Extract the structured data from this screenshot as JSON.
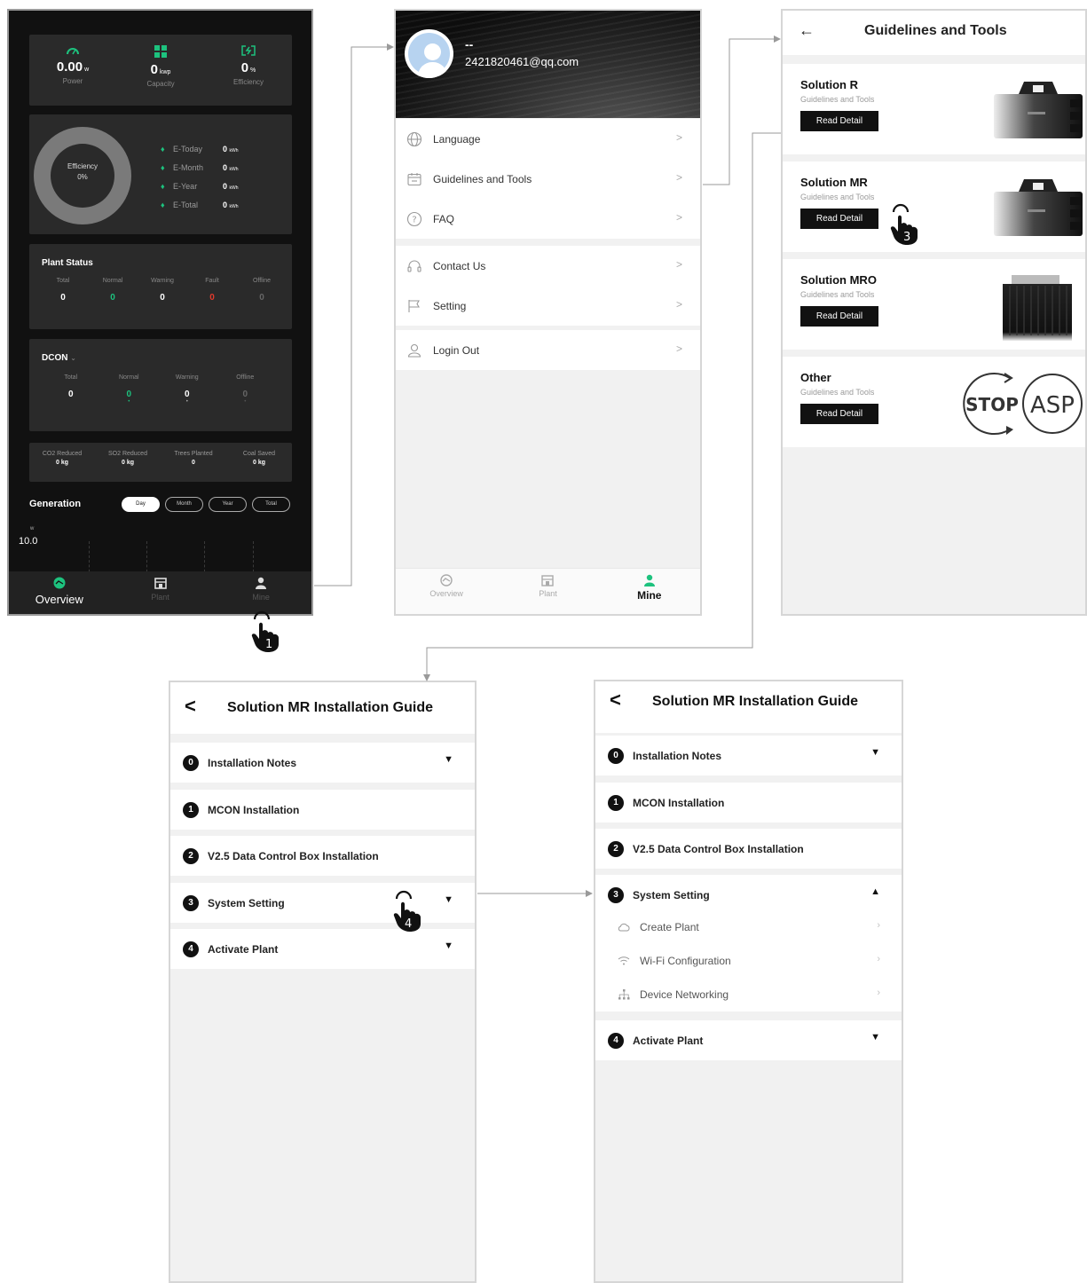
{
  "overview": {
    "metrics": [
      {
        "value": "0.00",
        "unit": "w",
        "label": "Power",
        "icon": "gauge-icon"
      },
      {
        "value": "0",
        "unit": "kwp",
        "label": "Capacity",
        "icon": "grid-icon"
      },
      {
        "value": "0",
        "unit": "%",
        "label": "Efficiency",
        "icon": "efficiency-icon"
      }
    ],
    "efficiency_label": "Efficiency",
    "efficiency_value": "0%",
    "energy": [
      {
        "label": "E-Today",
        "value": "0",
        "unit": "kWh"
      },
      {
        "label": "E-Month",
        "value": "0",
        "unit": "kWh"
      },
      {
        "label": "E-Year",
        "value": "0",
        "unit": "kWh"
      },
      {
        "label": "E-Total",
        "value": "0",
        "unit": "kWh"
      }
    ],
    "plant_status": {
      "title": "Plant Status",
      "cols": [
        {
          "label": "Total",
          "value": "0"
        },
        {
          "label": "Normal",
          "value": "0"
        },
        {
          "label": "Warning",
          "value": "0"
        },
        {
          "label": "Fault",
          "value": "0"
        },
        {
          "label": "Offline",
          "value": "0"
        }
      ]
    },
    "dcon": {
      "title": "DCON",
      "cols": [
        {
          "label": "Total",
          "value": "0"
        },
        {
          "label": "Normal",
          "value": "0"
        },
        {
          "label": "Warning",
          "value": "0"
        },
        {
          "label": "Offline",
          "value": "0"
        }
      ]
    },
    "reductions": [
      {
        "label": "CO2 Reduced",
        "value": "0 kg"
      },
      {
        "label": "SO2 Reduced",
        "value": "0 kg"
      },
      {
        "label": "Trees Planted",
        "value": "0"
      },
      {
        "label": "Coal Saved",
        "value": "0 kg"
      }
    ],
    "generation": {
      "title": "Generation",
      "tabs": [
        "Day",
        "Month",
        "Year",
        "Total"
      ],
      "active_tab": "Day",
      "y_unit": "w",
      "y_tick": "10.0"
    },
    "tabbar": [
      "Overview",
      "Plant",
      "Mine"
    ]
  },
  "mine": {
    "user_name": "--",
    "email": "2421820461@qq.com",
    "menu_group_1": [
      {
        "label": "Language",
        "icon": "globe-icon"
      },
      {
        "label": "Guidelines and Tools",
        "icon": "calendar-icon"
      },
      {
        "label": "FAQ",
        "icon": "question-icon"
      }
    ],
    "menu_group_2": [
      {
        "label": "Contact Us",
        "icon": "headset-icon"
      },
      {
        "label": "Setting",
        "icon": "flag-icon"
      }
    ],
    "menu_group_3": [
      {
        "label": "Login Out",
        "icon": "user-icon"
      }
    ],
    "chevron": ">",
    "tabbar": [
      "Overview",
      "Plant",
      "Mine"
    ]
  },
  "guidelines": {
    "title": "Guidelines and Tools",
    "solutions": [
      {
        "name": "Solution R",
        "subtitle": "Guidelines and Tools",
        "button": "Read Detail"
      },
      {
        "name": "Solution MR",
        "subtitle": "Guidelines and Tools",
        "button": "Read Detail"
      },
      {
        "name": "Solution MRO",
        "subtitle": "Guidelines and Tools",
        "button": "Read Detail"
      },
      {
        "name": "Other",
        "subtitle": "Guidelines and Tools",
        "button": "Read Detail"
      }
    ],
    "logo_stop": "STOP",
    "logo_asp": "ASP"
  },
  "guide_collapsed": {
    "title": "Solution MR Installation Guide",
    "items": [
      {
        "num": "0",
        "label": "Installation Notes"
      },
      {
        "num": "1",
        "label": "MCON Installation"
      },
      {
        "num": "2",
        "label": "V2.5  Data Control Box Installation"
      },
      {
        "num": "3",
        "label": "System Setting"
      },
      {
        "num": "4",
        "label": "Activate Plant"
      }
    ]
  },
  "guide_expanded": {
    "title": "Solution MR Installation Guide",
    "items": [
      {
        "num": "0",
        "label": "Installation Notes"
      },
      {
        "num": "1",
        "label": "MCON Installation"
      },
      {
        "num": "2",
        "label": "V2.5  Data Control Box Installation"
      },
      {
        "num": "3",
        "label": "System Setting"
      },
      {
        "num": "4",
        "label": "Activate Plant"
      }
    ],
    "sub_items": [
      {
        "label": "Create Plant",
        "icon": "cloud-icon"
      },
      {
        "label": "Wi-Fi Configuration",
        "icon": "wifi-icon"
      },
      {
        "label": "Device Networking",
        "icon": "network-icon"
      }
    ]
  },
  "steps": [
    "1",
    "3",
    "4"
  ]
}
